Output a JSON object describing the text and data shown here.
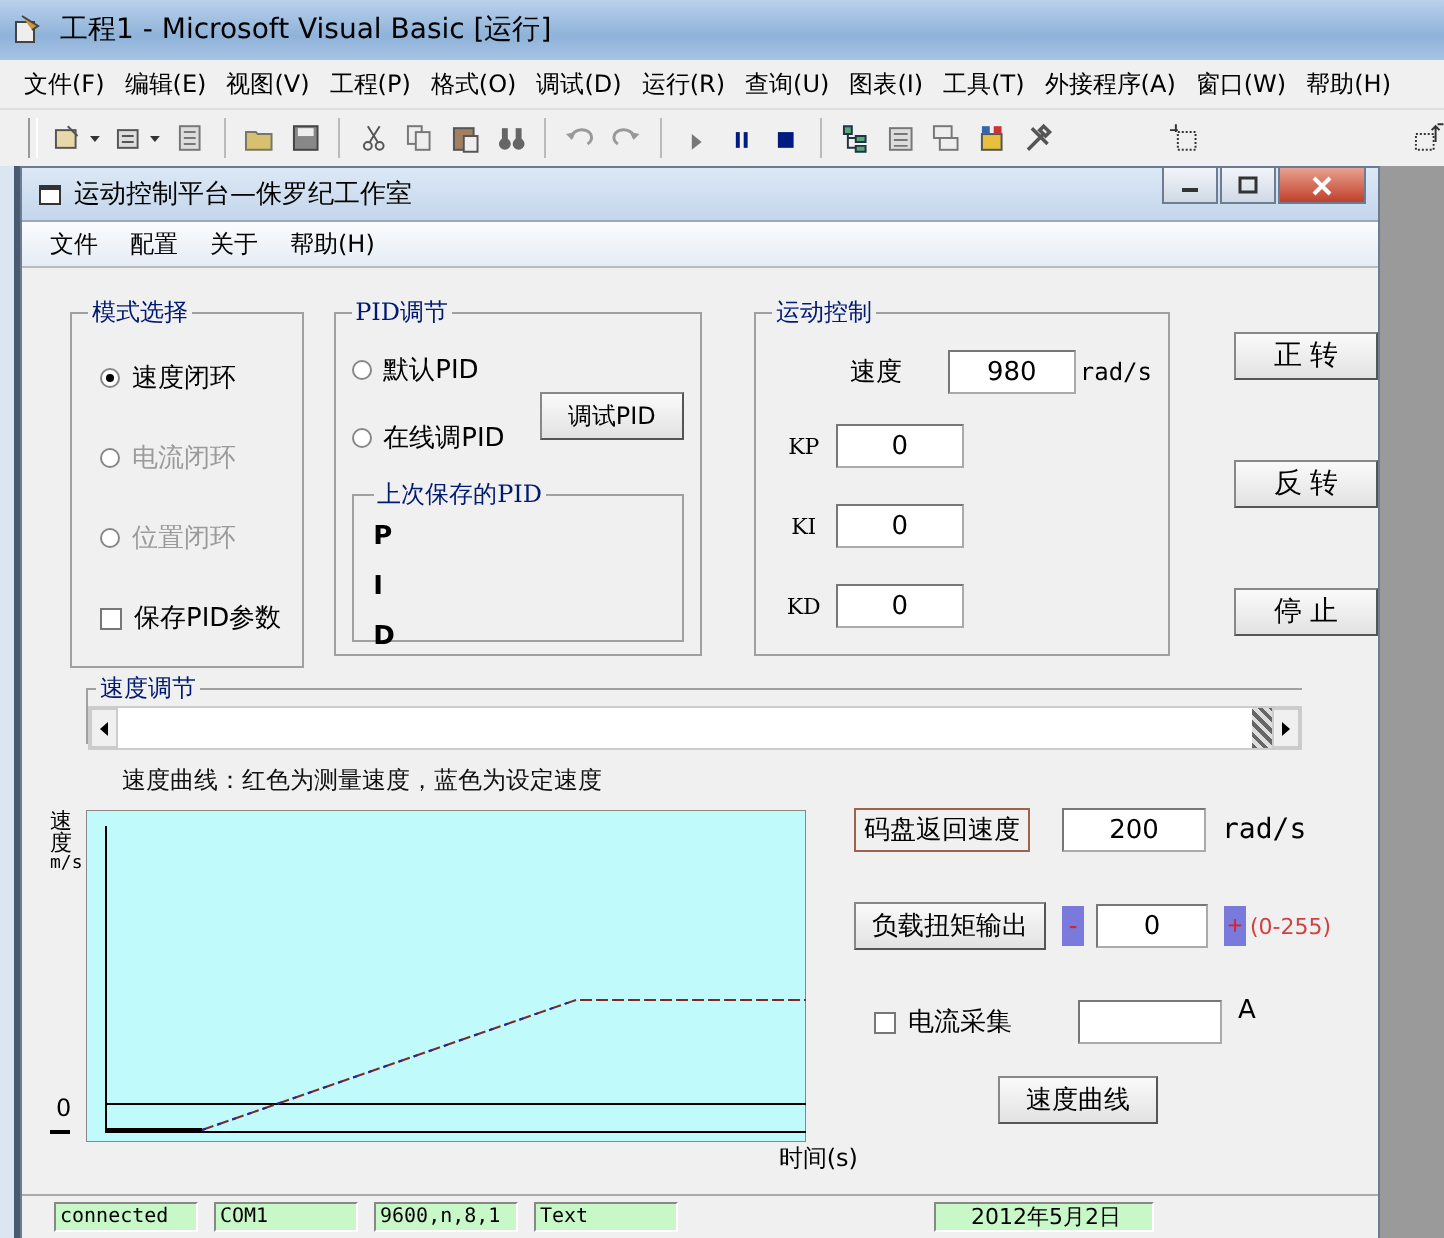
{
  "window": {
    "title": "工程1 - Microsoft Visual Basic [运行]"
  },
  "menu": [
    "文件(F)",
    "编辑(E)",
    "视图(V)",
    "工程(P)",
    "格式(O)",
    "调试(D)",
    "运行(R)",
    "查询(U)",
    "图表(I)",
    "工具(T)",
    "外接程序(A)",
    "窗口(W)",
    "帮助(H)"
  ],
  "form": {
    "title": "运动控制平台—侏罗纪工作室",
    "menu": [
      "文件",
      "配置",
      "关于",
      "帮助(H)"
    ]
  },
  "mode_group": {
    "title": "模式选择",
    "options": [
      {
        "label": "速度闭环",
        "selected": true,
        "disabled": false
      },
      {
        "label": "电流闭环",
        "selected": false,
        "disabled": true
      },
      {
        "label": "位置闭环",
        "selected": false,
        "disabled": true
      }
    ],
    "save_checkbox": {
      "label": "保存PID参数",
      "checked": false
    }
  },
  "pid_group": {
    "title": "PID调节",
    "options": [
      {
        "label": "默认PID",
        "selected": false
      },
      {
        "label": "在线调PID",
        "selected": false
      }
    ],
    "tune_button": "调试PID",
    "saved": {
      "title": "上次保存的PID",
      "rows": [
        "P",
        "I",
        "D"
      ]
    }
  },
  "motion_group": {
    "title": "运动控制",
    "fields": [
      {
        "label": "速度",
        "value": "980",
        "unit": "rad/s"
      },
      {
        "label": "KP",
        "value": "0"
      },
      {
        "label": "KI",
        "value": "0"
      },
      {
        "label": "KD",
        "value": "0"
      }
    ]
  },
  "direction_buttons": [
    "正 转",
    "反 转",
    "停 止"
  ],
  "speed_adjust": {
    "title": "速度调节"
  },
  "chart": {
    "caption": "速度曲线：红色为测量速度，蓝色为设定速度",
    "ylabel": "速度",
    "yunit": "m/s",
    "zero_label": "0",
    "xlabel": "时间(s)"
  },
  "encoder": {
    "label": "码盘返回速度",
    "value": "200",
    "unit": "rad/s"
  },
  "torque": {
    "button": "负载扭矩输出",
    "minus": "-",
    "value": "0",
    "plus": "+",
    "range": "(0-255)"
  },
  "current": {
    "label": "电流采集",
    "checked": false,
    "unit": "A"
  },
  "curve_button": "速度曲线",
  "status_bar": [
    "connected",
    "COM1",
    "9600,n,8,1",
    "Text",
    "2012年5月2日"
  ]
}
